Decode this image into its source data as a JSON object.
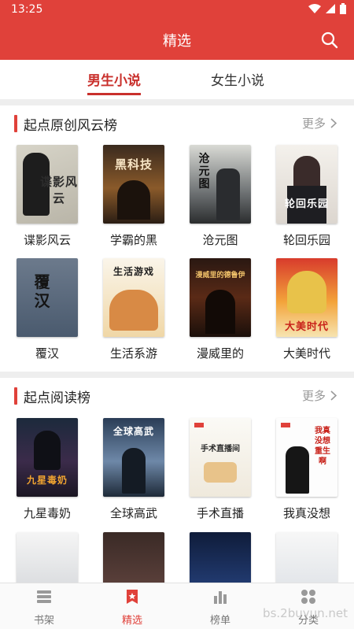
{
  "status": {
    "time": "13:25"
  },
  "appbar": {
    "title": "精选"
  },
  "tabs": [
    {
      "label": "男生小说",
      "active": true
    },
    {
      "label": "女生小说",
      "active": false
    }
  ],
  "sections": [
    {
      "title": "起点原创风云榜",
      "more": "更多",
      "books": [
        {
          "title": "谍影风云",
          "cover_text": "谍影风云"
        },
        {
          "title": "学霸的黑",
          "cover_text": "黑科技"
        },
        {
          "title": "沧元图",
          "cover_text": "沧元图"
        },
        {
          "title": "轮回乐园",
          "cover_text": "轮回乐园"
        },
        {
          "title": "覆汉",
          "cover_text": "覆汉"
        },
        {
          "title": "生活系游",
          "cover_text": "生活游戏"
        },
        {
          "title": "漫威里的",
          "cover_text": "漫威里的德鲁伊"
        },
        {
          "title": "大美时代",
          "cover_text": "大美时代"
        }
      ]
    },
    {
      "title": "起点阅读榜",
      "more": "更多",
      "books": [
        {
          "title": "九星毒奶",
          "cover_text": "九星毒奶"
        },
        {
          "title": "全球高武",
          "cover_text": "全球高武"
        },
        {
          "title": "手术直播",
          "cover_text": "手术直播间"
        },
        {
          "title": "我真没想",
          "cover_text": "我真没想重生啊"
        }
      ]
    }
  ],
  "bottom_nav": [
    {
      "label": "书架",
      "active": false
    },
    {
      "label": "精选",
      "active": true
    },
    {
      "label": "榜单",
      "active": false
    },
    {
      "label": "分类",
      "active": false
    }
  ],
  "watermark": "bs.2buyun.net",
  "colors": {
    "brand": "#e0413a",
    "tab_active": "#c9302c"
  }
}
